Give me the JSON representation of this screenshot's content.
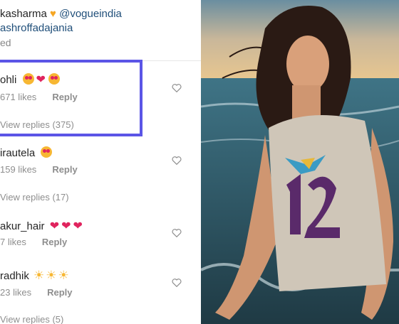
{
  "caption": {
    "user": "kasharma",
    "mention1": "@vogueindia",
    "mention2": "ashroffadajania",
    "edited": "ed"
  },
  "comments": [
    {
      "name": "ohli",
      "likes": "671 likes",
      "reply": "Reply",
      "replies": "View replies (375)",
      "emoji": "heart-eyes, red-heart, heart-eyes"
    },
    {
      "name": "irautela",
      "likes": "159 likes",
      "reply": "Reply",
      "replies": "View replies (17)",
      "emoji": "heart-eyes"
    },
    {
      "name": "akur_hair",
      "likes": "7 likes",
      "reply": "Reply",
      "replies": "",
      "emoji": "pink-hearts"
    },
    {
      "name": "radhik",
      "likes": "23 likes",
      "reply": "Reply",
      "replies": "View replies (5)",
      "emoji": "suns"
    }
  ],
  "colors": {
    "highlight": "#5b55e6",
    "mention": "#1f4e79",
    "meta": "#8e8e8e"
  }
}
